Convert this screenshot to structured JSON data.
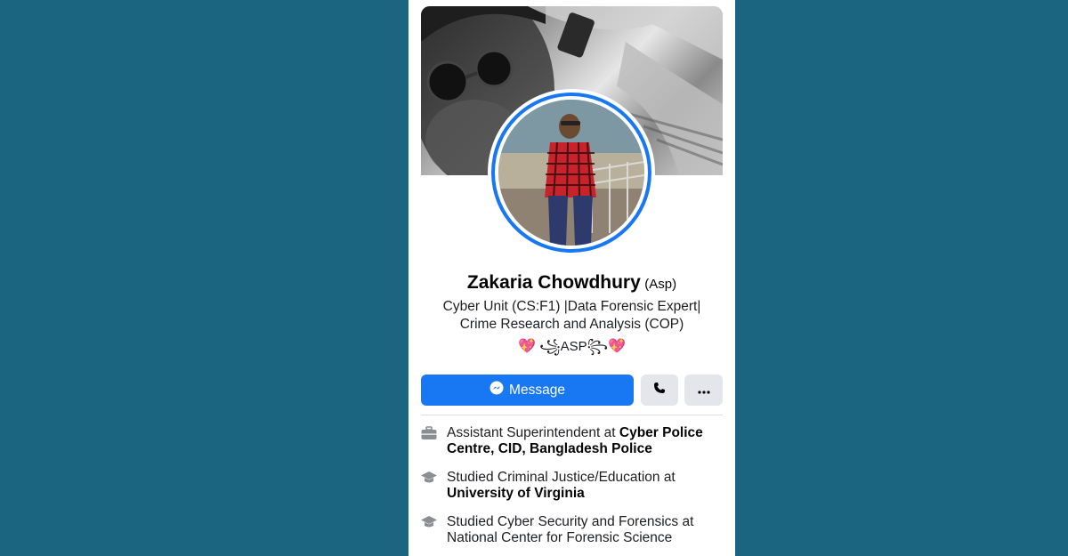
{
  "profile": {
    "name": "Zakaria Chowdhury",
    "name_suffix": "(Asp)",
    "bio_line1": "Cyber Unit (CS:F1) |Data Forensic Expert|",
    "bio_line2": "Crime Research and Analysis (COP)",
    "tagline": {
      "heart_left": "💖",
      "deco_left": "꧁",
      "text": "ASP",
      "deco_right": "꧂",
      "heart_right": "💖"
    }
  },
  "actions": {
    "message_label": "Message",
    "call_icon": "phone-icon",
    "more_icon": "more-icon"
  },
  "intro": {
    "work": {
      "icon": "briefcase-icon",
      "prefix": "Assistant Superintendent at ",
      "place_line1": "Cyber Police",
      "place_line2": "Centre, CID, Bangladesh Police"
    },
    "education1": {
      "icon": "graduation-cap-icon",
      "prefix": "Studied Criminal Justice/Education at",
      "place": "University of Virginia"
    },
    "education2": {
      "icon": "graduation-cap-icon",
      "prefix": "Studied Cyber Security and Forensics at",
      "place": "National Center for Forensic Science"
    }
  },
  "colors": {
    "background": "#1b6580",
    "accent": "#1877f2",
    "button_gray": "#e4e6eb"
  }
}
